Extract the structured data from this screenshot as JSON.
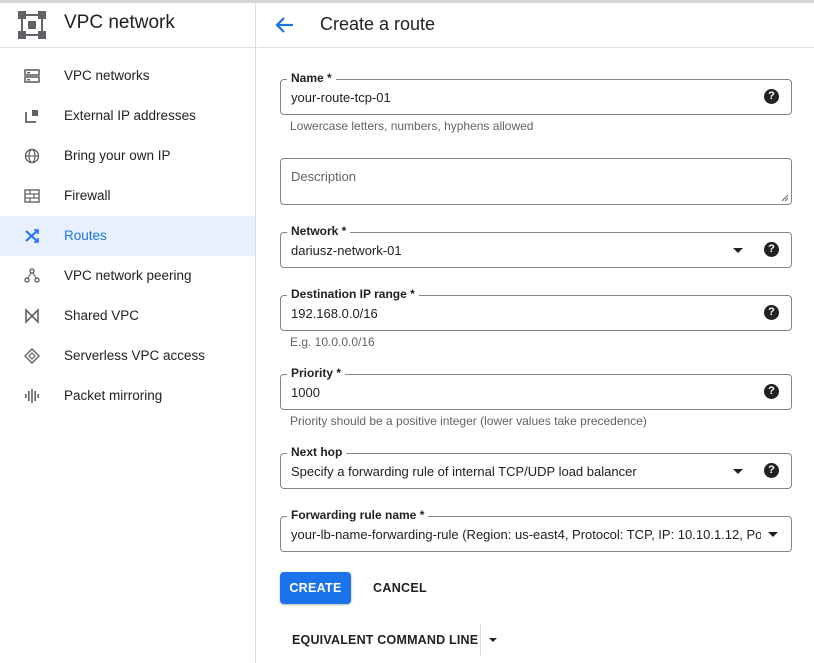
{
  "sidebar": {
    "title": "VPC network",
    "items": [
      {
        "label": "VPC networks",
        "icon": "vpc-networks-icon"
      },
      {
        "label": "External IP addresses",
        "icon": "external-ip-icon"
      },
      {
        "label": "Bring your own IP",
        "icon": "globe-icon"
      },
      {
        "label": "Firewall",
        "icon": "firewall-icon"
      },
      {
        "label": "Routes",
        "icon": "routes-icon",
        "active": true
      },
      {
        "label": "VPC network peering",
        "icon": "peering-icon"
      },
      {
        "label": "Shared VPC",
        "icon": "shared-vpc-icon"
      },
      {
        "label": "Serverless VPC access",
        "icon": "serverless-icon"
      },
      {
        "label": "Packet mirroring",
        "icon": "packet-mirroring-icon"
      }
    ]
  },
  "header": {
    "title": "Create a route"
  },
  "form": {
    "name": {
      "label": "Name *",
      "value": "your-route-tcp-01",
      "hint": "Lowercase letters, numbers, hyphens allowed"
    },
    "description": {
      "placeholder": "Description"
    },
    "network": {
      "label": "Network *",
      "value": "dariusz-network-01"
    },
    "destination": {
      "label": "Destination IP range *",
      "value": "192.168.0.0/16",
      "hint": "E.g. 10.0.0.0/16"
    },
    "priority": {
      "label": "Priority *",
      "value": "1000",
      "hint": "Priority should be a positive integer (lower values take precedence)"
    },
    "next_hop": {
      "label": "Next hop",
      "value": "Specify a forwarding rule of internal TCP/UDP load balancer"
    },
    "forwarding_rule": {
      "label": "Forwarding rule name *",
      "value": "your-lb-name-forwarding-rule (Region: us-east4, Protocol: TCP, IP: 10.10.1.12, Po..."
    },
    "help_glyph": "?"
  },
  "actions": {
    "create": "CREATE",
    "cancel": "CANCEL",
    "equivalent": "EQUIVALENT COMMAND LINE"
  },
  "colors": {
    "accent": "#1a73e8",
    "active_bg": "#e8f0fe",
    "border": "#80868b"
  }
}
